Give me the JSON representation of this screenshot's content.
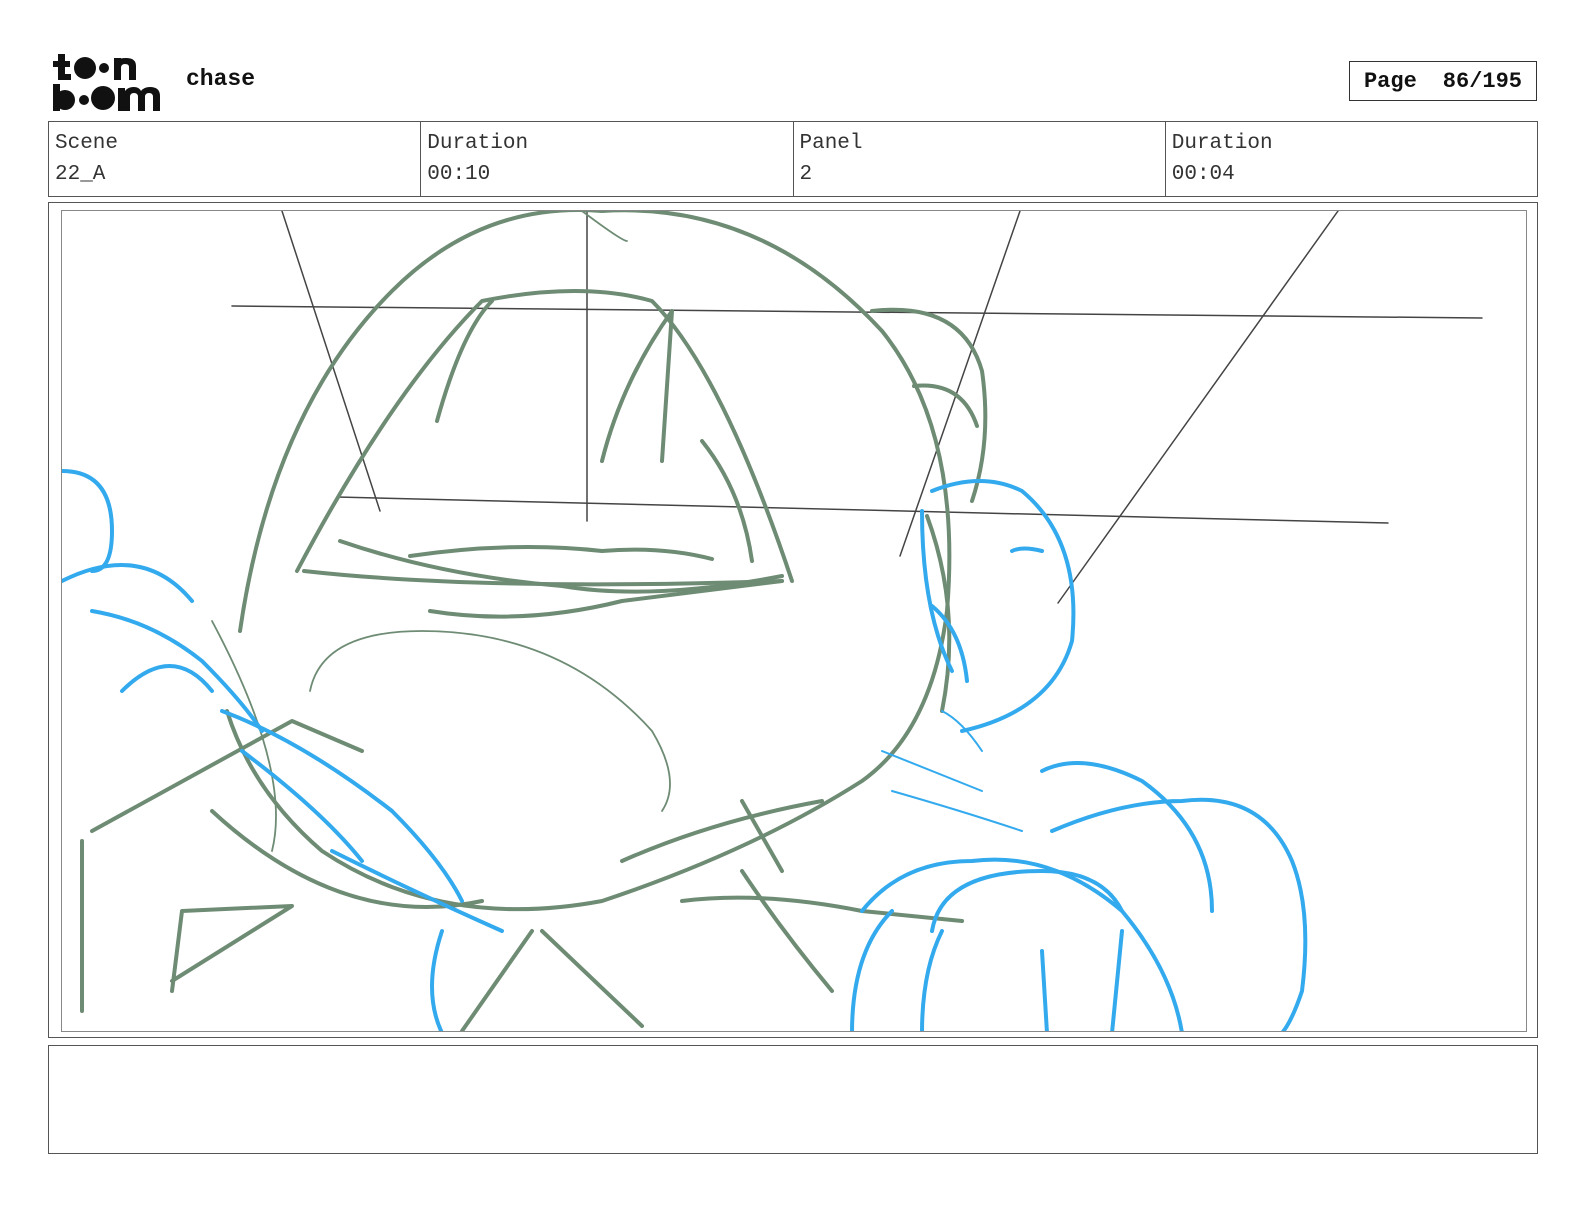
{
  "header": {
    "logo_text": "toon boom",
    "project_title": "chase",
    "page_label": "Page",
    "page_number": "86/195"
  },
  "info": {
    "scene_label": "Scene",
    "scene_value": "22_A",
    "scene_duration_label": "Duration",
    "scene_duration_value": "00:10",
    "panel_label": "Panel",
    "panel_value": "2",
    "panel_duration_label": "Duration",
    "panel_duration_value": "00:04"
  },
  "colors": {
    "sketch_green": "#6e8b74",
    "sketch_blue": "#33aaee",
    "guide_line": "#444444"
  },
  "notes": {
    "text": ""
  }
}
